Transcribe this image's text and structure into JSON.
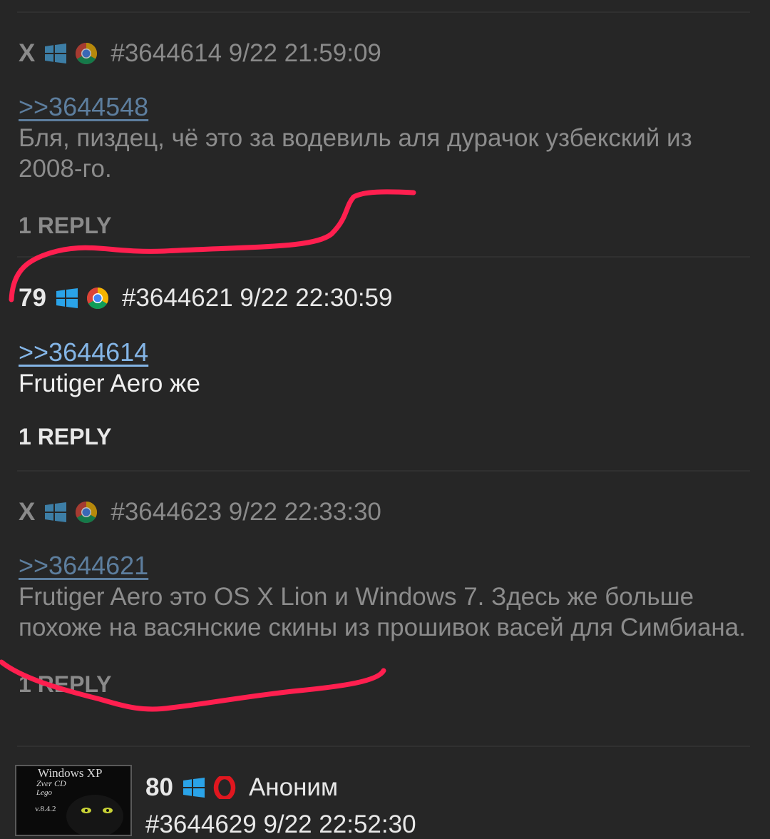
{
  "colors": {
    "background": "#262626",
    "annotation": "#ff1f4f",
    "link": "#84b5e6"
  },
  "posts": [
    {
      "signature": "X",
      "os_icon": "windows-icon",
      "browser_icon": "chrome-icon",
      "id_time": "#3644614 9/22 21:59:09",
      "quote": ">>3644548",
      "text": "Бля, пиздец, чё это за водевиль аля дурачок узбекский из 2008-го.",
      "replies": "1 REPLY"
    },
    {
      "signature": "79",
      "os_icon": "windows-icon",
      "browser_icon": "chrome-icon",
      "id_time": "#3644621 9/22 22:30:59",
      "quote": ">>3644614",
      "text": "Frutiger Aero же",
      "replies": "1 REPLY"
    },
    {
      "signature": "X",
      "os_icon": "windows-icon",
      "browser_icon": "chrome-icon",
      "id_time": "#3644623 9/22 22:33:30",
      "quote": ">>3644621",
      "text": "Frutiger Aero это OS X Lion и Windows 7. Здесь же больше похоже на васянские скины из прошивок васей для Симбиана.",
      "replies": "1 REPLY"
    },
    {
      "signature": "80",
      "os_icon": "windows-icon",
      "browser_icon": "opera-icon",
      "name": "Аноним",
      "id_time": "#3644629 9/22 22:52:30",
      "thumbnail": {
        "line1": "Windows XP",
        "line2": "Zver CD",
        "line3": "Lego",
        "line4": "v.8.4.2"
      }
    }
  ]
}
